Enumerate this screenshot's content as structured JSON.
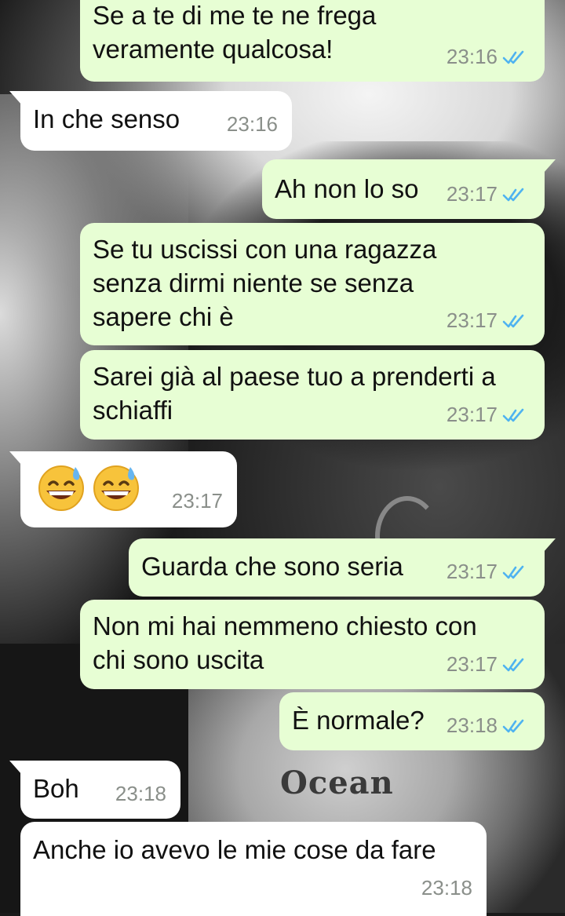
{
  "messages": [
    {
      "id": "m1",
      "direction": "out",
      "text": "Se a te di me te ne frega\nveramente qualcosa!",
      "time": "23:16",
      "read": true
    },
    {
      "id": "m2",
      "direction": "in",
      "text": "In che senso",
      "time": "23:16"
    },
    {
      "id": "m3",
      "direction": "out",
      "text": "Ah non lo so",
      "time": "23:17",
      "read": true
    },
    {
      "id": "m4",
      "direction": "out",
      "text": "Se tu uscissi con una ragazza\nsenza dirmi niente se senza\nsapere chi è",
      "time": "23:17",
      "read": true
    },
    {
      "id": "m5",
      "direction": "out",
      "text": "Sarei già al paese tuo a prenderti a\nschiaffi",
      "time": "23:17",
      "read": true
    },
    {
      "id": "m6",
      "direction": "in",
      "emoji": [
        "grinning-face-with-sweat",
        "grinning-face-with-sweat"
      ],
      "time": "23:17"
    },
    {
      "id": "m7",
      "direction": "out",
      "text": "Guarda che sono seria",
      "time": "23:17",
      "read": true
    },
    {
      "id": "m8",
      "direction": "out",
      "text": "Non mi hai nemmeno chiesto con\nchi sono uscita",
      "time": "23:17",
      "read": true
    },
    {
      "id": "m9",
      "direction": "out",
      "text": "È normale?",
      "time": "23:18",
      "read": true
    },
    {
      "id": "m10",
      "direction": "in",
      "text": "Boh",
      "time": "23:18"
    },
    {
      "id": "m11",
      "direction": "in",
      "text": "Anche io avevo le mie cose da fare",
      "time": "23:18"
    }
  ],
  "wallpaper": {
    "tattoo_text": "Ocean"
  },
  "colors": {
    "outgoing_bubble": "#e7fed4",
    "incoming_bubble": "#ffffff",
    "read_ticks": "#4fb3f0",
    "timestamp": "#8a8f8a"
  },
  "icons": {
    "read_receipt": "double-check-icon"
  }
}
